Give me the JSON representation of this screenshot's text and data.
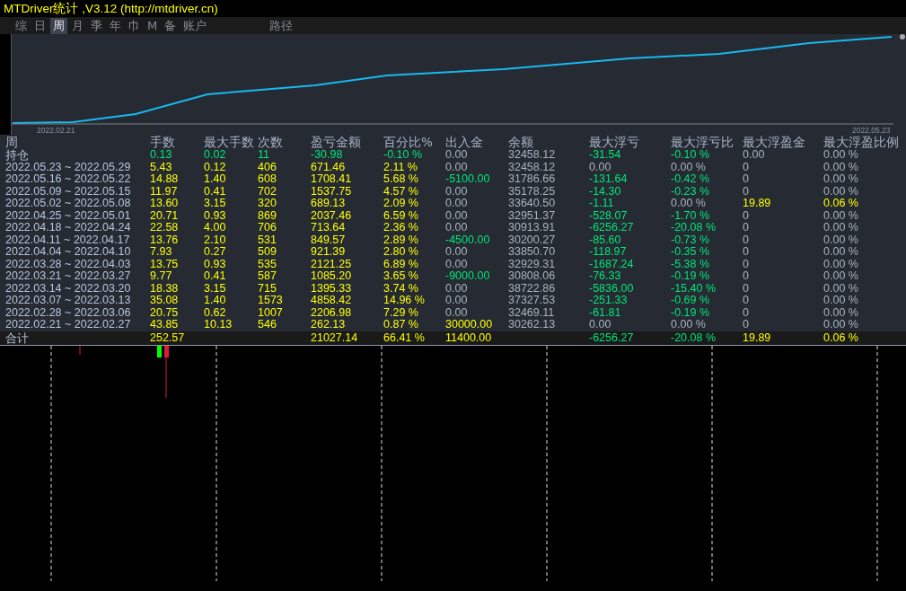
{
  "title": "MTDriver统计 ,V3.12 (http://mtdriver.cn)",
  "tabs": [
    {
      "label": "综",
      "selected": false
    },
    {
      "label": "日",
      "selected": false
    },
    {
      "label": "周",
      "selected": true
    },
    {
      "label": "月",
      "selected": false
    },
    {
      "label": "季",
      "selected": false
    },
    {
      "label": "年",
      "selected": false
    },
    {
      "label": "巾",
      "selected": false
    },
    {
      "label": "M",
      "selected": false
    },
    {
      "label": "备",
      "selected": false
    },
    {
      "label": "账户",
      "selected": false
    },
    {
      "label": "路径",
      "selected": false
    }
  ],
  "chart": {
    "start_label": "2022.02.21",
    "end_label": "2022.05.23"
  },
  "table": {
    "columns": [
      "周",
      "手数",
      "最大手数",
      "次数",
      "盈亏金额",
      "百分比%",
      "出入金",
      "余额",
      "最大浮亏",
      "最大浮亏比",
      "最大浮盈金",
      "最大浮盈比例"
    ],
    "rows": [
      {
        "cells": [
          {
            "text": "持仓",
            "color": "#b9c6dc"
          },
          {
            "text": "0.13",
            "color": "#00e676"
          },
          {
            "text": "0.02",
            "color": "#00e676"
          },
          {
            "text": "11",
            "color": "#00e676"
          },
          {
            "text": "-30.98",
            "color": "#00e676"
          },
          {
            "text": "-0.10 %",
            "color": "#00e676"
          },
          {
            "text": "0.00",
            "color": "#aab3bf"
          },
          {
            "text": "32458.12",
            "color": "#aab3bf"
          },
          {
            "text": "-31.54",
            "color": "#00e676"
          },
          {
            "text": "-0.10 %",
            "color": "#00e676"
          },
          {
            "text": "0.00",
            "color": "#aab3bf"
          },
          {
            "text": "0.00 %",
            "color": "#aab3bf"
          }
        ]
      },
      {
        "cells": [
          {
            "text": "2022.05.23 ~ 2022.05.29",
            "color": "#b9c6dc"
          },
          {
            "text": "5.43",
            "color": "#ffff00"
          },
          {
            "text": "0.12",
            "color": "#ffff00"
          },
          {
            "text": "406",
            "color": "#ffff00"
          },
          {
            "text": "671.46",
            "color": "#ffff00"
          },
          {
            "text": "2.11 %",
            "color": "#ffff00"
          },
          {
            "text": "0.00",
            "color": "#aab3bf"
          },
          {
            "text": "32458.12",
            "color": "#aab3bf"
          },
          {
            "text": "0.00",
            "color": "#aab3bf"
          },
          {
            "text": "0.00 %",
            "color": "#aab3bf"
          },
          {
            "text": "0",
            "color": "#aab3bf"
          },
          {
            "text": "0.00 %",
            "color": "#aab3bf"
          }
        ]
      },
      {
        "cells": [
          {
            "text": "2022.05.16 ~ 2022.05.22",
            "color": "#b9c6dc"
          },
          {
            "text": "14.88",
            "color": "#ffff00"
          },
          {
            "text": "1.40",
            "color": "#ffff00"
          },
          {
            "text": "608",
            "color": "#ffff00"
          },
          {
            "text": "1708.41",
            "color": "#ffff00"
          },
          {
            "text": "5.68 %",
            "color": "#ffff00"
          },
          {
            "text": "-5100.00",
            "color": "#00e676"
          },
          {
            "text": "31786.66",
            "color": "#aab3bf"
          },
          {
            "text": "-131.64",
            "color": "#00e676"
          },
          {
            "text": "-0.42 %",
            "color": "#00e676"
          },
          {
            "text": "0",
            "color": "#aab3bf"
          },
          {
            "text": "0.00 %",
            "color": "#aab3bf"
          }
        ]
      },
      {
        "cells": [
          {
            "text": "2022.05.09 ~ 2022.05.15",
            "color": "#b9c6dc"
          },
          {
            "text": "11.97",
            "color": "#ffff00"
          },
          {
            "text": "0.41",
            "color": "#ffff00"
          },
          {
            "text": "702",
            "color": "#ffff00"
          },
          {
            "text": "1537.75",
            "color": "#ffff00"
          },
          {
            "text": "4.57 %",
            "color": "#ffff00"
          },
          {
            "text": "0.00",
            "color": "#aab3bf"
          },
          {
            "text": "35178.25",
            "color": "#aab3bf"
          },
          {
            "text": "-14.30",
            "color": "#00e676"
          },
          {
            "text": "-0.23 %",
            "color": "#00e676"
          },
          {
            "text": "0",
            "color": "#aab3bf"
          },
          {
            "text": "0.00 %",
            "color": "#aab3bf"
          }
        ]
      },
      {
        "cells": [
          {
            "text": "2022.05.02 ~ 2022.05.08",
            "color": "#b9c6dc"
          },
          {
            "text": "13.60",
            "color": "#ffff00"
          },
          {
            "text": "3.15",
            "color": "#ffff00"
          },
          {
            "text": "320",
            "color": "#ffff00"
          },
          {
            "text": "689.13",
            "color": "#ffff00"
          },
          {
            "text": "2.09 %",
            "color": "#ffff00"
          },
          {
            "text": "0.00",
            "color": "#aab3bf"
          },
          {
            "text": "33640.50",
            "color": "#aab3bf"
          },
          {
            "text": "-1.11",
            "color": "#00e676"
          },
          {
            "text": "0.00 %",
            "color": "#aab3bf"
          },
          {
            "text": "19.89",
            "color": "#ffff00"
          },
          {
            "text": "0.06 %",
            "color": "#ffff00"
          }
        ]
      },
      {
        "cells": [
          {
            "text": "2022.04.25 ~ 2022.05.01",
            "color": "#b9c6dc"
          },
          {
            "text": "20.71",
            "color": "#ffff00"
          },
          {
            "text": "0.93",
            "color": "#ffff00"
          },
          {
            "text": "869",
            "color": "#ffff00"
          },
          {
            "text": "2037.46",
            "color": "#ffff00"
          },
          {
            "text": "6.59 %",
            "color": "#ffff00"
          },
          {
            "text": "0.00",
            "color": "#aab3bf"
          },
          {
            "text": "32951.37",
            "color": "#aab3bf"
          },
          {
            "text": "-528.07",
            "color": "#00e676"
          },
          {
            "text": "-1.70 %",
            "color": "#00e676"
          },
          {
            "text": "0",
            "color": "#aab3bf"
          },
          {
            "text": "0.00 %",
            "color": "#aab3bf"
          }
        ]
      },
      {
        "cells": [
          {
            "text": "2022.04.18 ~ 2022.04.24",
            "color": "#b9c6dc"
          },
          {
            "text": "22.58",
            "color": "#ffff00"
          },
          {
            "text": "4.00",
            "color": "#ffff00"
          },
          {
            "text": "706",
            "color": "#ffff00"
          },
          {
            "text": "713.64",
            "color": "#ffff00"
          },
          {
            "text": "2.36 %",
            "color": "#ffff00"
          },
          {
            "text": "0.00",
            "color": "#aab3bf"
          },
          {
            "text": "30913.91",
            "color": "#aab3bf"
          },
          {
            "text": "-6256.27",
            "color": "#00e676"
          },
          {
            "text": "-20.08 %",
            "color": "#00e676"
          },
          {
            "text": "0",
            "color": "#aab3bf"
          },
          {
            "text": "0.00 %",
            "color": "#aab3bf"
          }
        ]
      },
      {
        "cells": [
          {
            "text": "2022.04.11 ~ 2022.04.17",
            "color": "#b9c6dc"
          },
          {
            "text": "13.76",
            "color": "#ffff00"
          },
          {
            "text": "2.10",
            "color": "#ffff00"
          },
          {
            "text": "531",
            "color": "#ffff00"
          },
          {
            "text": "849.57",
            "color": "#ffff00"
          },
          {
            "text": "2.89 %",
            "color": "#ffff00"
          },
          {
            "text": "-4500.00",
            "color": "#00e676"
          },
          {
            "text": "30200.27",
            "color": "#aab3bf"
          },
          {
            "text": "-85.60",
            "color": "#00e676"
          },
          {
            "text": "-0.73 %",
            "color": "#00e676"
          },
          {
            "text": "0",
            "color": "#aab3bf"
          },
          {
            "text": "0.00 %",
            "color": "#aab3bf"
          }
        ]
      },
      {
        "cells": [
          {
            "text": "2022.04.04 ~ 2022.04.10",
            "color": "#b9c6dc"
          },
          {
            "text": "7.93",
            "color": "#ffff00"
          },
          {
            "text": "0.27",
            "color": "#ffff00"
          },
          {
            "text": "509",
            "color": "#ffff00"
          },
          {
            "text": "921.39",
            "color": "#ffff00"
          },
          {
            "text": "2.80 %",
            "color": "#ffff00"
          },
          {
            "text": "0.00",
            "color": "#aab3bf"
          },
          {
            "text": "33850.70",
            "color": "#aab3bf"
          },
          {
            "text": "-118.97",
            "color": "#00e676"
          },
          {
            "text": "-0.35 %",
            "color": "#00e676"
          },
          {
            "text": "0",
            "color": "#aab3bf"
          },
          {
            "text": "0.00 %",
            "color": "#aab3bf"
          }
        ]
      },
      {
        "cells": [
          {
            "text": "2022.03.28 ~ 2022.04.03",
            "color": "#b9c6dc"
          },
          {
            "text": "13.75",
            "color": "#ffff00"
          },
          {
            "text": "0.93",
            "color": "#ffff00"
          },
          {
            "text": "535",
            "color": "#ffff00"
          },
          {
            "text": "2121.25",
            "color": "#ffff00"
          },
          {
            "text": "6.89 %",
            "color": "#ffff00"
          },
          {
            "text": "0.00",
            "color": "#aab3bf"
          },
          {
            "text": "32929.31",
            "color": "#aab3bf"
          },
          {
            "text": "-1687.24",
            "color": "#00e676"
          },
          {
            "text": "-5.38 %",
            "color": "#00e676"
          },
          {
            "text": "0",
            "color": "#aab3bf"
          },
          {
            "text": "0.00 %",
            "color": "#aab3bf"
          }
        ]
      },
      {
        "cells": [
          {
            "text": "2022.03.21 ~ 2022.03.27",
            "color": "#b9c6dc"
          },
          {
            "text": "9.77",
            "color": "#ffff00"
          },
          {
            "text": "0.41",
            "color": "#ffff00"
          },
          {
            "text": "587",
            "color": "#ffff00"
          },
          {
            "text": "1085.20",
            "color": "#ffff00"
          },
          {
            "text": "3.65 %",
            "color": "#ffff00"
          },
          {
            "text": "-9000.00",
            "color": "#00e676"
          },
          {
            "text": "30808.06",
            "color": "#aab3bf"
          },
          {
            "text": "-76.33",
            "color": "#00e676"
          },
          {
            "text": "-0.19 %",
            "color": "#00e676"
          },
          {
            "text": "0",
            "color": "#aab3bf"
          },
          {
            "text": "0.00 %",
            "color": "#aab3bf"
          }
        ]
      },
      {
        "cells": [
          {
            "text": "2022.03.14 ~ 2022.03.20",
            "color": "#b9c6dc"
          },
          {
            "text": "18.38",
            "color": "#ffff00"
          },
          {
            "text": "3.15",
            "color": "#ffff00"
          },
          {
            "text": "715",
            "color": "#ffff00"
          },
          {
            "text": "1395.33",
            "color": "#ffff00"
          },
          {
            "text": "3.74 %",
            "color": "#ffff00"
          },
          {
            "text": "0.00",
            "color": "#aab3bf"
          },
          {
            "text": "38722.86",
            "color": "#aab3bf"
          },
          {
            "text": "-5836.00",
            "color": "#00e676"
          },
          {
            "text": "-15.40 %",
            "color": "#00e676"
          },
          {
            "text": "0",
            "color": "#aab3bf"
          },
          {
            "text": "0.00 %",
            "color": "#aab3bf"
          }
        ]
      },
      {
        "cells": [
          {
            "text": "2022.03.07 ~ 2022.03.13",
            "color": "#b9c6dc"
          },
          {
            "text": "35.08",
            "color": "#ffff00"
          },
          {
            "text": "1.40",
            "color": "#ffff00"
          },
          {
            "text": "1573",
            "color": "#ffff00"
          },
          {
            "text": "4858.42",
            "color": "#ffff00"
          },
          {
            "text": "14.96 %",
            "color": "#ffff00"
          },
          {
            "text": "0.00",
            "color": "#aab3bf"
          },
          {
            "text": "37327.53",
            "color": "#aab3bf"
          },
          {
            "text": "-251.33",
            "color": "#00e676"
          },
          {
            "text": "-0.69 %",
            "color": "#00e676"
          },
          {
            "text": "0",
            "color": "#aab3bf"
          },
          {
            "text": "0.00 %",
            "color": "#aab3bf"
          }
        ]
      },
      {
        "cells": [
          {
            "text": "2022.02.28 ~ 2022.03.06",
            "color": "#b9c6dc"
          },
          {
            "text": "20.75",
            "color": "#ffff00"
          },
          {
            "text": "0.62",
            "color": "#ffff00"
          },
          {
            "text": "1007",
            "color": "#ffff00"
          },
          {
            "text": "2206.98",
            "color": "#ffff00"
          },
          {
            "text": "7.29 %",
            "color": "#ffff00"
          },
          {
            "text": "0.00",
            "color": "#aab3bf"
          },
          {
            "text": "32469.11",
            "color": "#aab3bf"
          },
          {
            "text": "-61.81",
            "color": "#00e676"
          },
          {
            "text": "-0.19 %",
            "color": "#00e676"
          },
          {
            "text": "0",
            "color": "#aab3bf"
          },
          {
            "text": "0.00 %",
            "color": "#aab3bf"
          }
        ]
      },
      {
        "cells": [
          {
            "text": "2022.02.21 ~ 2022.02.27",
            "color": "#b9c6dc"
          },
          {
            "text": "43.85",
            "color": "#ffff00"
          },
          {
            "text": "10.13",
            "color": "#ffff00"
          },
          {
            "text": "546",
            "color": "#ffff00"
          },
          {
            "text": "262.13",
            "color": "#ffff00"
          },
          {
            "text": "0.87 %",
            "color": "#ffff00"
          },
          {
            "text": "30000.00",
            "color": "#ffff00"
          },
          {
            "text": "30262.13",
            "color": "#aab3bf"
          },
          {
            "text": "0.00",
            "color": "#aab3bf"
          },
          {
            "text": "0.00 %",
            "color": "#aab3bf"
          },
          {
            "text": "0",
            "color": "#aab3bf"
          },
          {
            "text": "0.00 %",
            "color": "#aab3bf"
          }
        ]
      }
    ],
    "total": {
      "cells": [
        {
          "text": "合计",
          "color": "#b9c6dc"
        },
        {
          "text": "252.57",
          "color": "#ffff00"
        },
        "",
        "",
        {
          "text": "21027.14",
          "color": "#ffff00"
        },
        {
          "text": "66.41 %",
          "color": "#ffff00"
        },
        {
          "text": "11400.00",
          "color": "#ffff00"
        },
        "",
        {
          "text": "-6256.27",
          "color": "#00e676"
        },
        {
          "text": "-20.08 %",
          "color": "#00e676"
        },
        {
          "text": "19.89",
          "color": "#ffff00"
        },
        {
          "text": "0.06 %",
          "color": "#ffff00"
        }
      ]
    }
  }
}
